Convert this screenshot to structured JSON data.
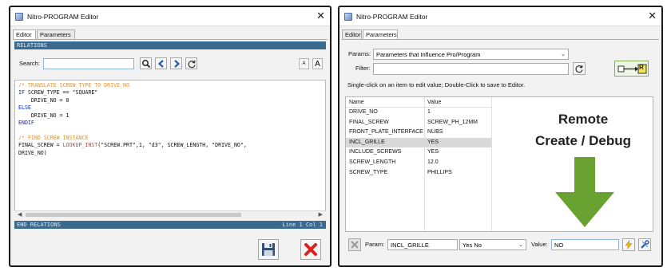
{
  "editor": {
    "title": "Nitro-PROGRAM Editor",
    "tabs": [
      "Editor",
      "Parameters"
    ],
    "banner_top": "RELATIONS",
    "banner_bottom_left": "END RELATIONS",
    "banner_bottom_right": "Line 1 Col 1",
    "search_label": "Search:",
    "search_value": "",
    "font_small": "A",
    "font_large": "A",
    "code_lines": [
      {
        "parts": [
          {
            "t": "/* TRANSLATE SCREW_TYPE TO DRIVE_NO",
            "c": "comment"
          }
        ]
      },
      {
        "parts": [
          {
            "t": "IF ",
            "c": "kw"
          },
          {
            "t": "SCREW_TYPE == \"SQUARE\"",
            "c": "plain"
          }
        ]
      },
      {
        "parts": [
          {
            "t": "    DRIVE_NO = 0",
            "c": "plain"
          }
        ]
      },
      {
        "parts": [
          {
            "t": "ELSE",
            "c": "kw"
          }
        ]
      },
      {
        "parts": [
          {
            "t": "    DRIVE_NO = 1",
            "c": "plain"
          }
        ]
      },
      {
        "parts": [
          {
            "t": "ENDIF",
            "c": "kw"
          }
        ]
      },
      {
        "parts": [
          {
            "t": "",
            "c": "plain"
          }
        ]
      },
      {
        "parts": [
          {
            "t": "/* FIND SCREW INSTANCE",
            "c": "comment"
          }
        ]
      },
      {
        "parts": [
          {
            "t": "FINAL_SCREW = ",
            "c": "plain"
          },
          {
            "t": "LOOKUP_INST",
            "c": "fn"
          },
          {
            "t": "(\"SCREW.PRT\",1, \"d3\", SCREW_LENGTH, \"DRIVE_NO\",",
            "c": "plain"
          }
        ]
      },
      {
        "parts": [
          {
            "t": "DRIVE_NO)",
            "c": "plain"
          }
        ]
      }
    ]
  },
  "params": {
    "title": "Nitro-PROGRAM Editor",
    "tabs": [
      "Editor",
      "Parameters"
    ],
    "params_label": "Params:",
    "params_selected": "Parameters that Influence Pro/Program",
    "filter_label": "Filter:",
    "filter_value": "",
    "hint": "Single-click on an item to edit value; Double-Click to save to Editor.",
    "columns": [
      "Name",
      "Value"
    ],
    "rows": [
      {
        "name": "DRIVE_NO",
        "value": "1",
        "selected": false
      },
      {
        "name": "FINAL_SCREW",
        "value": "SCREW_PH_12MM",
        "selected": false
      },
      {
        "name": "FRONT_PLATE_INTERFACE",
        "value": "NUBS",
        "selected": false
      },
      {
        "name": "INCL_GRILLE",
        "value": "YES",
        "selected": true
      },
      {
        "name": "INCLUDE_SCREWS",
        "value": "YES",
        "selected": false
      },
      {
        "name": "SCREW_LENGTH",
        "value": "12.0",
        "selected": false
      },
      {
        "name": "SCREW_TYPE",
        "value": "PHILLIPS",
        "selected": false
      }
    ],
    "remote_line1": "Remote",
    "remote_line2": "Create / Debug",
    "param_label": "Param:",
    "param_value": "INCL_GRILLE",
    "type_value": "Yes No",
    "value_label": "Value:",
    "value_value": "NO",
    "relations_icon_letter": "R"
  },
  "colors": {
    "banner": "#3a6a8f",
    "comment": "#e8922c",
    "keyword": "#0b2bc4",
    "function": "#e0402a",
    "arrow_green": "#6aa232",
    "cancel_red": "#d8261f"
  }
}
